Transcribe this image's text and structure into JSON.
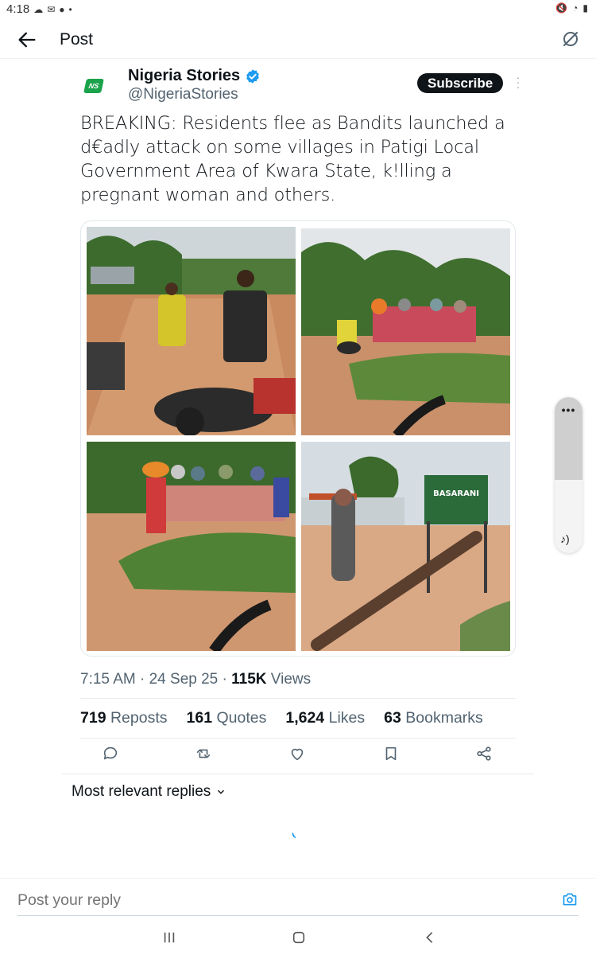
{
  "status_bar": {
    "time": "4:18"
  },
  "header": {
    "title": "Post"
  },
  "author": {
    "name": "Nigeria Stories",
    "handle": "@NigeriaStories",
    "avatar_text": "NS",
    "subscribe_label": "Subscribe"
  },
  "post": {
    "text": "BREAKING: Residents flee as Bandits launched a d€adly attack on some villages in Patigi Local Government Area of Kwara State, k!lling a pregnant woman and others.",
    "photo_sign_text": "BASARANI"
  },
  "meta": {
    "time": "7:15 AM",
    "date": "24 Sep 25",
    "views_count": "115K",
    "views_label": "Views"
  },
  "stats": {
    "reposts_count": "719",
    "reposts_label": "Reposts",
    "quotes_count": "161",
    "quotes_label": "Quotes",
    "likes_count": "1,624",
    "likes_label": "Likes",
    "bookmarks_count": "63",
    "bookmarks_label": "Bookmarks"
  },
  "replies": {
    "filter_label": "Most relevant replies"
  },
  "reply_bar": {
    "placeholder": "Post your reply"
  },
  "scroll_overlay": {
    "dots": "•••"
  },
  "colors": {
    "accent": "#1d9bf0",
    "text": "#0f1419",
    "secondary": "#536471"
  }
}
